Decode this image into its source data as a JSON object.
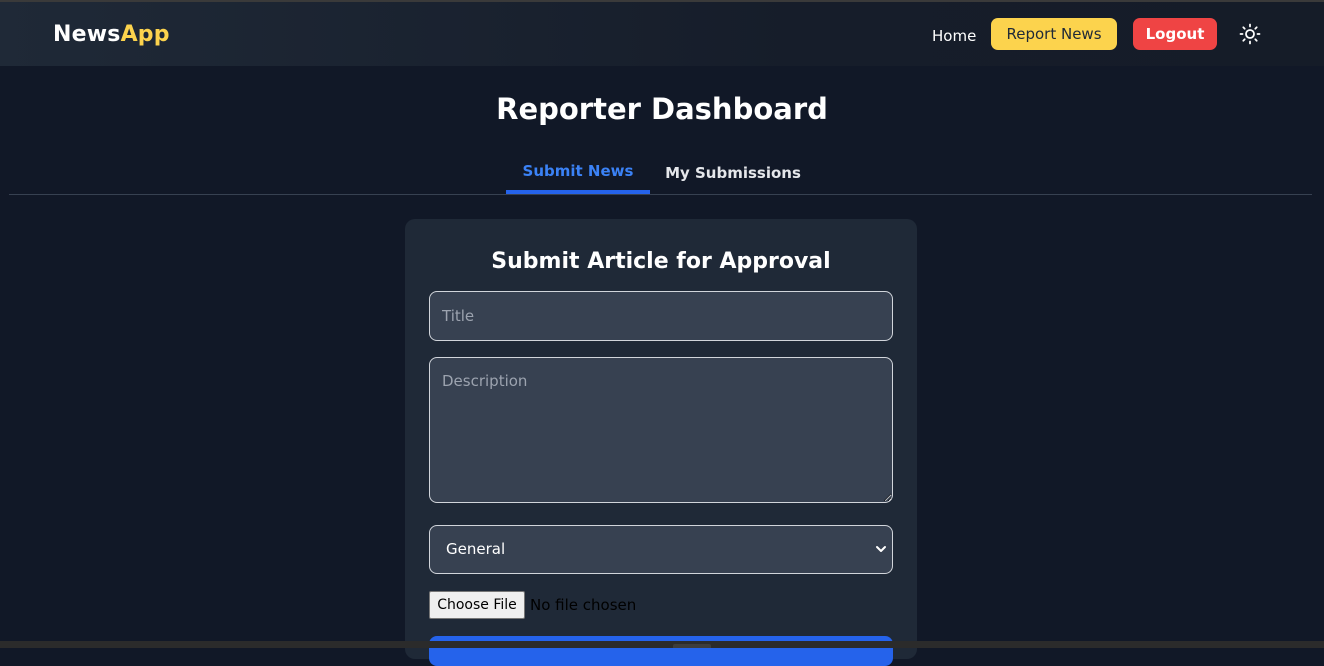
{
  "navbar": {
    "logo_part1": "News",
    "logo_part2": "App",
    "home_label": "Home",
    "report_label": "Report News",
    "logout_label": "Logout",
    "theme_icon": "sun-icon"
  },
  "page": {
    "title": "Reporter Dashboard"
  },
  "tabs": [
    {
      "label": "Submit News",
      "active": true
    },
    {
      "label": "My Submissions",
      "active": false
    }
  ],
  "form": {
    "heading": "Submit Article for Approval",
    "title_placeholder": "Title",
    "title_value": "",
    "description_placeholder": "Description",
    "description_value": "",
    "category_selected": "General",
    "file_button_label": "Choose File",
    "file_status": "No file chosen"
  },
  "colors": {
    "background": "#111827",
    "navbar": "#1f2937",
    "accent_yellow": "#fcd34d",
    "logout_red": "#ef4444",
    "active_tab_blue": "#3b82f6",
    "card": "#1f2937",
    "input": "#374151"
  }
}
